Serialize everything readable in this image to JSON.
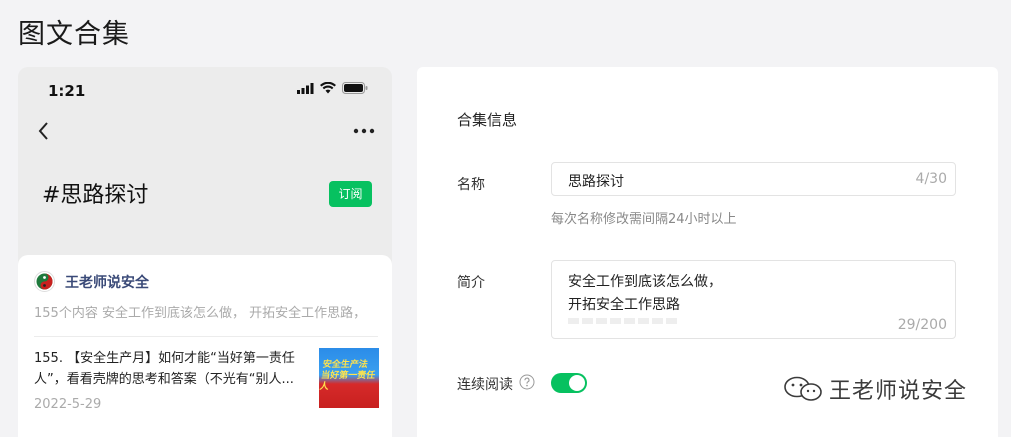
{
  "page": {
    "title": "图文合集"
  },
  "preview": {
    "time": "1:21",
    "hashtag_title": "#思路探讨",
    "subscribe_label": "订阅",
    "account_name": "王老师说安全",
    "account_desc": "155个内容  安全工作到底该怎么做， 开拓安全工作思路，",
    "article": {
      "title": "155. 【安全生产月】如何才能“当好第一责任人”，看看壳牌的思考和答案（不光有“别人...",
      "date": "2022-5-29",
      "thumb_line1": "安全生产法",
      "thumb_line2": "当好第一责任人"
    }
  },
  "settings": {
    "section_title": "合集信息",
    "name_label": "名称",
    "name_value": "思路探讨",
    "name_count": "4/30",
    "name_hint": "每次名称修改需间隔24小时以上",
    "intro_label": "简介",
    "intro_lines": [
      "安全工作到底该怎么做，",
      "开拓安全工作思路"
    ],
    "intro_count": "29/200",
    "continuous_label": "连续阅读",
    "continuous_enabled": true
  },
  "watermark": {
    "text": "王老师说安全"
  },
  "colors": {
    "accent": "#07c160",
    "account_name": "#3a4a78"
  }
}
